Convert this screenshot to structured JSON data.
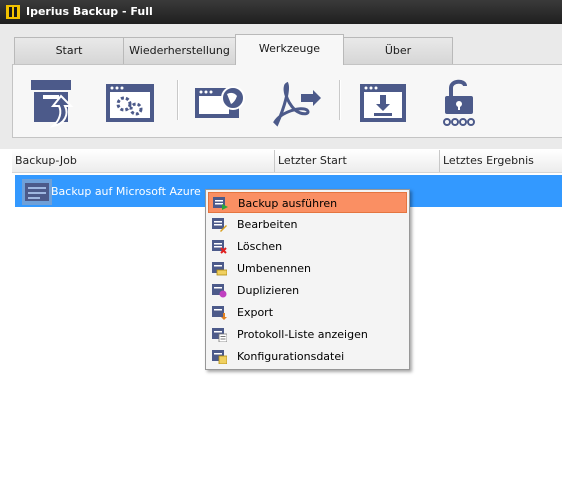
{
  "window": {
    "title": "Iperius Backup - Full"
  },
  "tabs": [
    {
      "label": "Start",
      "active": false
    },
    {
      "label": "Wiederherstellung",
      "active": false
    },
    {
      "label": "Werkzeuge",
      "active": true
    },
    {
      "label": "Über",
      "active": false
    }
  ],
  "toolbar": {
    "tools": [
      {
        "icon": "box-restore-icon"
      },
      {
        "icon": "window-settings-icon"
      },
      {
        "icon": "window-globe-icon"
      },
      {
        "icon": "pdf-export-icon"
      },
      {
        "icon": "download-window-icon"
      },
      {
        "icon": "unlock-password-icon"
      }
    ]
  },
  "list": {
    "columns": [
      "Backup-Job",
      "Letzter Start",
      "Letztes Ergebnis"
    ],
    "rows": [
      {
        "name": "Backup auf Microsoft Azure",
        "last_start": "",
        "last_result": ""
      }
    ]
  },
  "context_menu": {
    "items": [
      {
        "label": "Backup ausführen",
        "icon": "run-backup-icon",
        "highlighted": true
      },
      {
        "label": "Bearbeiten",
        "icon": "edit-icon",
        "highlighted": false
      },
      {
        "label": "Löschen",
        "icon": "delete-icon",
        "highlighted": false
      },
      {
        "label": "Umbenennen",
        "icon": "rename-icon",
        "highlighted": false
      },
      {
        "label": "Duplizieren",
        "icon": "duplicate-icon",
        "highlighted": false
      },
      {
        "label": "Export",
        "icon": "export-icon",
        "highlighted": false
      },
      {
        "label": "Protokoll-Liste anzeigen",
        "icon": "log-list-icon",
        "highlighted": false
      },
      {
        "label": "Konfigurationsdatei",
        "icon": "config-file-icon",
        "highlighted": false
      }
    ]
  },
  "colors": {
    "accent_icon": "#4c5a8a",
    "selection": "#3399ff",
    "menu_highlight": "#fa8f63"
  }
}
